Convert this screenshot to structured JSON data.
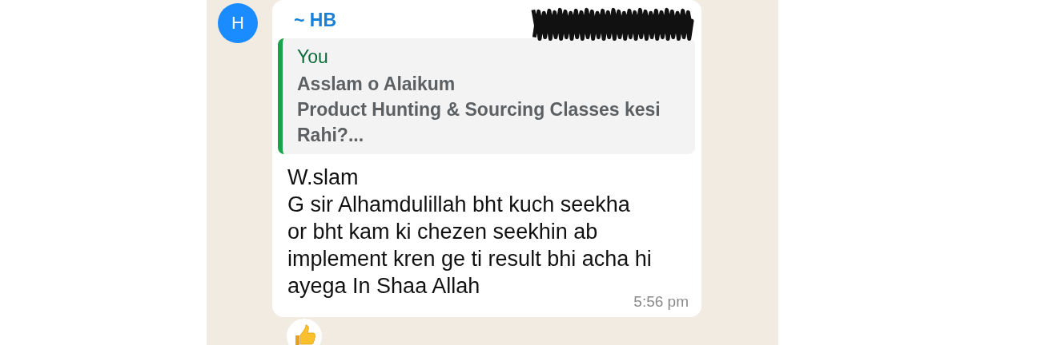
{
  "message": {
    "avatar_letter": "H",
    "sender": "~ HB",
    "quote": {
      "author": "You",
      "text": "Asslam o Alaikum\nProduct Hunting & Sourcing Classes kesi\nRahi?..."
    },
    "text": "W.slam\nG sir Alhamdulillah bht kuch seekha\nor bht kam ki chezen seekhin ab\nimplement kren ge ti result bhi acha hi\nayega In Shaa Allah",
    "time": "5:56 pm",
    "reaction": {
      "kind": "thumbs_up"
    }
  }
}
